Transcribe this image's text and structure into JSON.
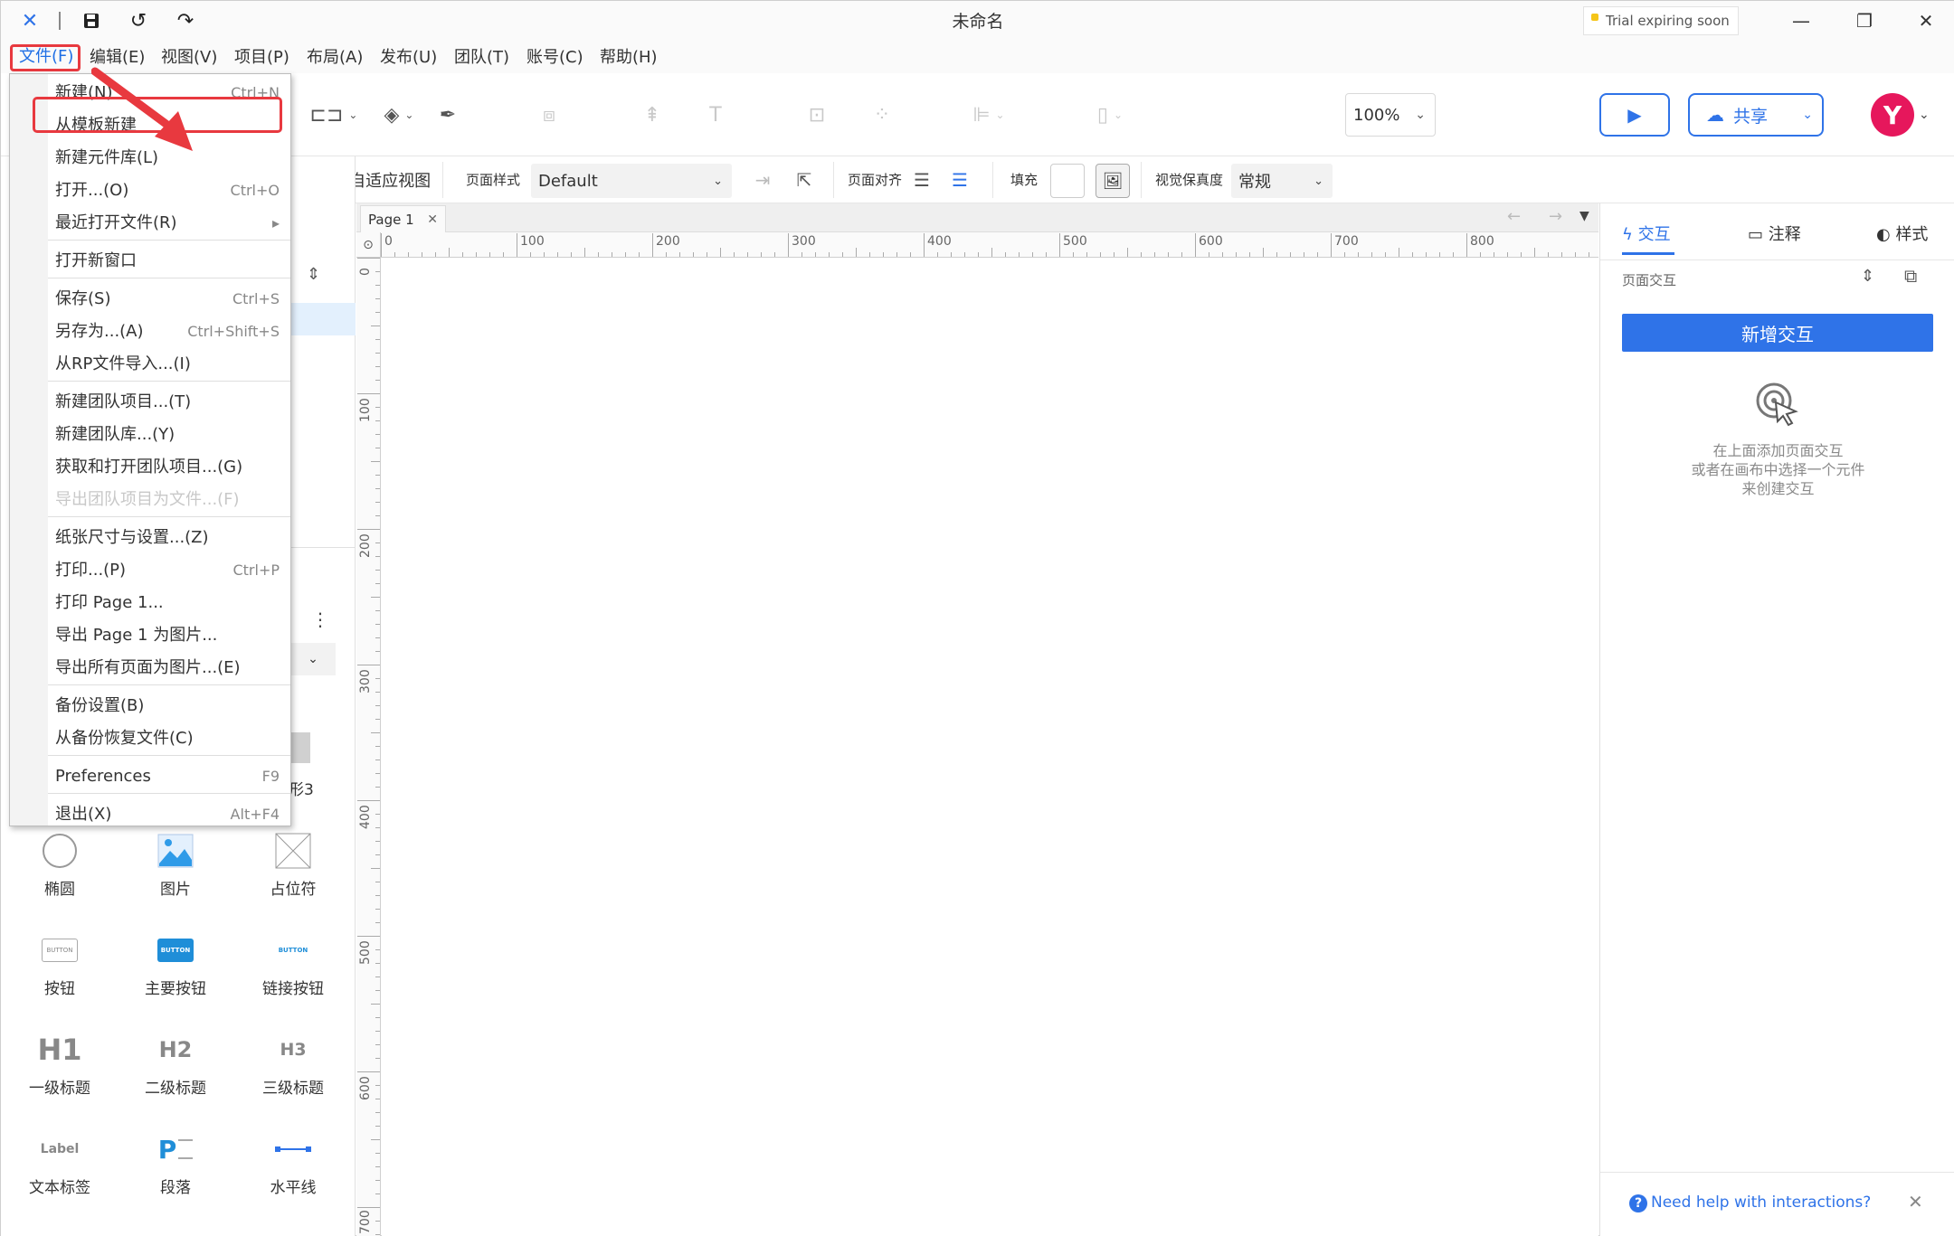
{
  "window": {
    "title": "未命名",
    "trial": "Trial expiring soon"
  },
  "menubar": {
    "items": [
      "文件(F)",
      "编辑(E)",
      "视图(V)",
      "项目(P)",
      "布局(A)",
      "发布(U)",
      "团队(T)",
      "账号(C)",
      "帮助(H)"
    ]
  },
  "toolbar": {
    "zoom": "100%",
    "share_label": "共享",
    "avatar_letter": "Y"
  },
  "propbar": {
    "add_adaptive_view": "添加自适应视图",
    "page_style_label": "页面样式",
    "page_style_value": "Default",
    "page_align_label": "页面对齐",
    "fill_label": "填充",
    "fidelity_label": "视觉保真度",
    "fidelity_value": "常规"
  },
  "file_menu": {
    "items": [
      {
        "label": "新建(N)",
        "shortcut": "Ctrl+N"
      },
      {
        "label": "从模板新建",
        "shortcut": ""
      },
      {
        "label": "新建元件库(L)",
        "shortcut": ""
      },
      {
        "label": "打开...(O)",
        "shortcut": "Ctrl+O"
      },
      {
        "label": "最近打开文件(R)",
        "shortcut": "▸"
      },
      {
        "label": "打开新窗口",
        "shortcut": ""
      },
      {
        "label": "保存(S)",
        "shortcut": "Ctrl+S"
      },
      {
        "label": "另存为...(A)",
        "shortcut": "Ctrl+Shift+S"
      },
      {
        "label": "从RP文件导入...(I)",
        "shortcut": ""
      },
      {
        "label": "新建团队项目...(T)",
        "shortcut": ""
      },
      {
        "label": "新建团队库...(Y)",
        "shortcut": ""
      },
      {
        "label": "获取和打开团队项目...(G)",
        "shortcut": ""
      },
      {
        "label": "导出团队项目为文件...(F)",
        "shortcut": ""
      },
      {
        "label": "纸张尺寸与设置...(Z)",
        "shortcut": ""
      },
      {
        "label": "打印...(P)",
        "shortcut": "Ctrl+P"
      },
      {
        "label": "打印 Page 1...",
        "shortcut": ""
      },
      {
        "label": "导出 Page 1 为图片...",
        "shortcut": ""
      },
      {
        "label": "导出所有页面为图片...(E)",
        "shortcut": ""
      },
      {
        "label": "备份设置(B)",
        "shortcut": ""
      },
      {
        "label": "从备份恢复文件(C)",
        "shortcut": ""
      },
      {
        "label": "Preferences",
        "shortcut": "F9"
      },
      {
        "label": "退出(X)",
        "shortcut": "Alt+F4"
      }
    ]
  },
  "library": {
    "partial_label": "形3",
    "items": [
      {
        "label": "椭圆",
        "icon": "circle-icon"
      },
      {
        "label": "图片",
        "icon": "image-icon"
      },
      {
        "label": "占位符",
        "icon": "placeholder-icon"
      },
      {
        "label": "按钮",
        "icon": "button-icon",
        "icon_text": "BUTTON"
      },
      {
        "label": "主要按钮",
        "icon": "primary-button-icon",
        "icon_text": "BUTTON"
      },
      {
        "label": "链接按钮",
        "icon": "link-button-icon",
        "icon_text": "BUTTON"
      },
      {
        "label": "一级标题",
        "icon": "h1-icon",
        "icon_text": "H1"
      },
      {
        "label": "二级标题",
        "icon": "h2-icon",
        "icon_text": "H2"
      },
      {
        "label": "三级标题",
        "icon": "h3-icon",
        "icon_text": "H3"
      },
      {
        "label": "文本标签",
        "icon": "label-icon",
        "icon_text": "Label"
      },
      {
        "label": "段落",
        "icon": "paragraph-icon",
        "icon_text": "P"
      },
      {
        "label": "水平线",
        "icon": "horizontal-line-icon"
      }
    ]
  },
  "canvas": {
    "tab": "Page 1",
    "ruler_top": [
      "0",
      "100",
      "200",
      "300",
      "400",
      "500",
      "600",
      "700",
      "800"
    ],
    "ruler_left": [
      "0",
      "100",
      "200",
      "300",
      "400",
      "500",
      "600",
      "700"
    ]
  },
  "right_panel": {
    "tabs": [
      "交互",
      "注释",
      "样式"
    ],
    "page_interactions": "页面交互",
    "new_interaction": "新增交互",
    "hint_lines": [
      "在上面添加页面交互",
      "或者在画布中选择一个元件",
      "来创建交互"
    ],
    "help": "Need help with interactions?"
  },
  "colors": {
    "accent": "#2f73e8",
    "highlight": "#e8393f",
    "avatar": "#e6175c"
  }
}
